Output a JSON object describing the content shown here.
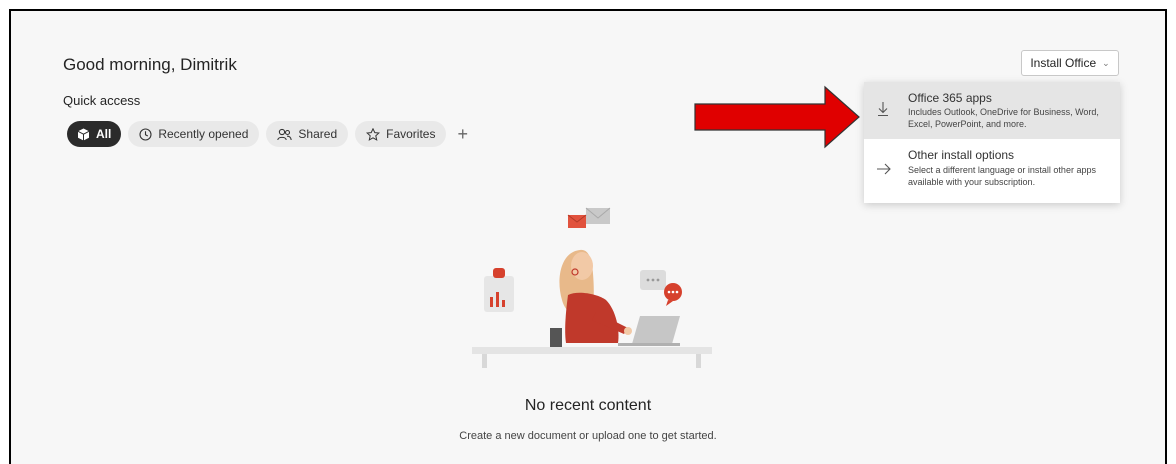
{
  "greeting": "Good morning, Dimitrik",
  "quick_access": {
    "title": "Quick access",
    "filters": [
      {
        "label": "All",
        "icon": "box-icon",
        "active": true
      },
      {
        "label": "Recently opened",
        "icon": "clock-icon",
        "active": false
      },
      {
        "label": "Shared",
        "icon": "people-icon",
        "active": false
      },
      {
        "label": "Favorites",
        "icon": "star-icon",
        "active": false
      }
    ],
    "add_symbol": "+"
  },
  "install": {
    "button_label": "Install Office",
    "menu": [
      {
        "title": "Office 365 apps",
        "description": "Includes Outlook, OneDrive for Business, Word, Excel, PowerPoint, and more.",
        "icon": "download-icon",
        "highlighted": true
      },
      {
        "title": "Other install options",
        "description": "Select a different language or install other apps available with your subscription.",
        "icon": "arrow-right-icon",
        "highlighted": false
      }
    ]
  },
  "empty_state": {
    "title": "No recent content",
    "subtitle": "Create a new document or upload one to get started."
  },
  "colors": {
    "annotation_arrow": "#e00000",
    "active_chip": "#2b2b2b",
    "illustration_accent": "#c0392b"
  }
}
